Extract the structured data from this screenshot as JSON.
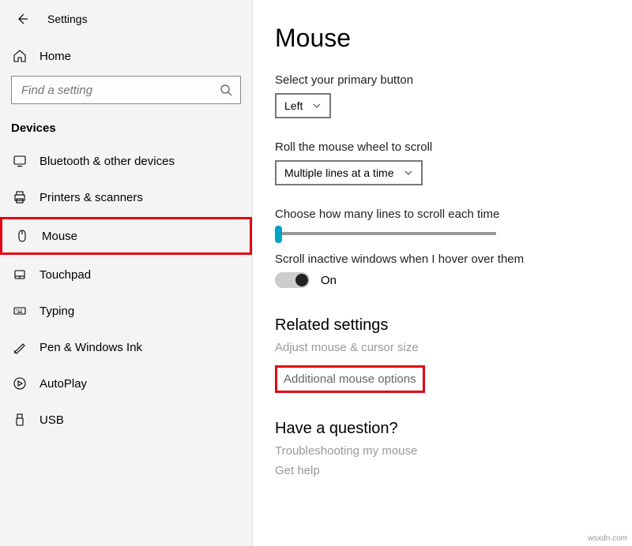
{
  "header": {
    "app_title": "Settings"
  },
  "home": {
    "label": "Home"
  },
  "search": {
    "placeholder": "Find a setting"
  },
  "category": {
    "title": "Devices"
  },
  "nav": {
    "items": [
      {
        "label": "Bluetooth & other devices"
      },
      {
        "label": "Printers & scanners"
      },
      {
        "label": "Mouse"
      },
      {
        "label": "Touchpad"
      },
      {
        "label": "Typing"
      },
      {
        "label": "Pen & Windows Ink"
      },
      {
        "label": "AutoPlay"
      },
      {
        "label": "USB"
      }
    ]
  },
  "main": {
    "title": "Mouse",
    "primary_button_label": "Select your primary button",
    "primary_button_value": "Left",
    "scroll_mode_label": "Roll the mouse wheel to scroll",
    "scroll_mode_value": "Multiple lines at a time",
    "lines_label": "Choose how many lines to scroll each time",
    "inactive_label": "Scroll inactive windows when I hover over them",
    "toggle_state": "On",
    "related_header": "Related settings",
    "related_link1": "Adjust mouse & cursor size",
    "related_link2": "Additional mouse options",
    "question_header": "Have a question?",
    "question_link1": "Troubleshooting my mouse",
    "question_link2": "Get help"
  },
  "watermark": "wsxdn.com"
}
